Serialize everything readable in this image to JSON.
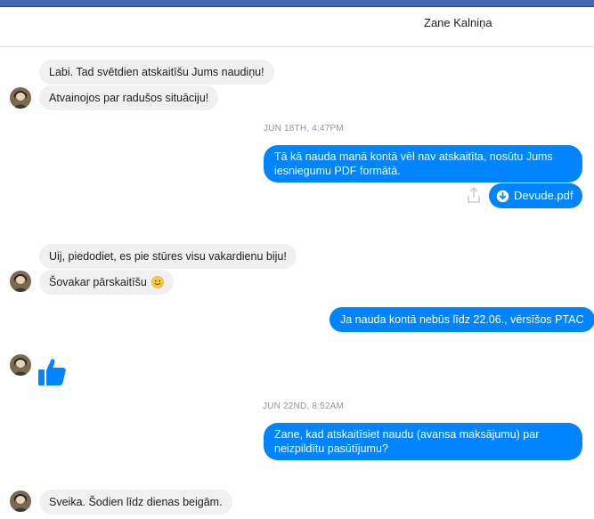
{
  "header": {
    "contact_name": "Zane Kalniņa"
  },
  "messages": {
    "m1": "Labi. Tad svētdien atskaitīšu Jums naudiņu!",
    "m2": "Atvainojos par radušos situāciju!",
    "ts1": "JUN 18TH, 4:47PM",
    "m3": "Tā kā nauda manā kontā vēl nav atskaitīta, nosūtu Jums iesniegumu PDF formātā.",
    "file_name": "Devude.pdf",
    "m4": "Uij, piedodiet, es pie stūres visu vakardienu biju!",
    "m5": "Šovakar pārskaitīšu",
    "m6": "Ja nauda kontā nebūs līdz 22.06., vērsīšos PTAC",
    "ts2": "JUN 22ND, 8:52AM",
    "m7": "Zane, kad atskaitīsiet naudu (avansa maksājumu) par neizpildītu pasūtījumu?",
    "m8": "Sveika. Šodien līdz dienas beigām."
  },
  "colors": {
    "outgoing_bubble": "#0084ff",
    "incoming_bubble": "#f1f0f0",
    "top_bar": "#4267b2",
    "timestamp": "#90949c"
  },
  "icons": [
    "download-icon",
    "share-icon",
    "slightly-smiling-face-emoji",
    "thumbs-up-icon",
    "avatar"
  ]
}
